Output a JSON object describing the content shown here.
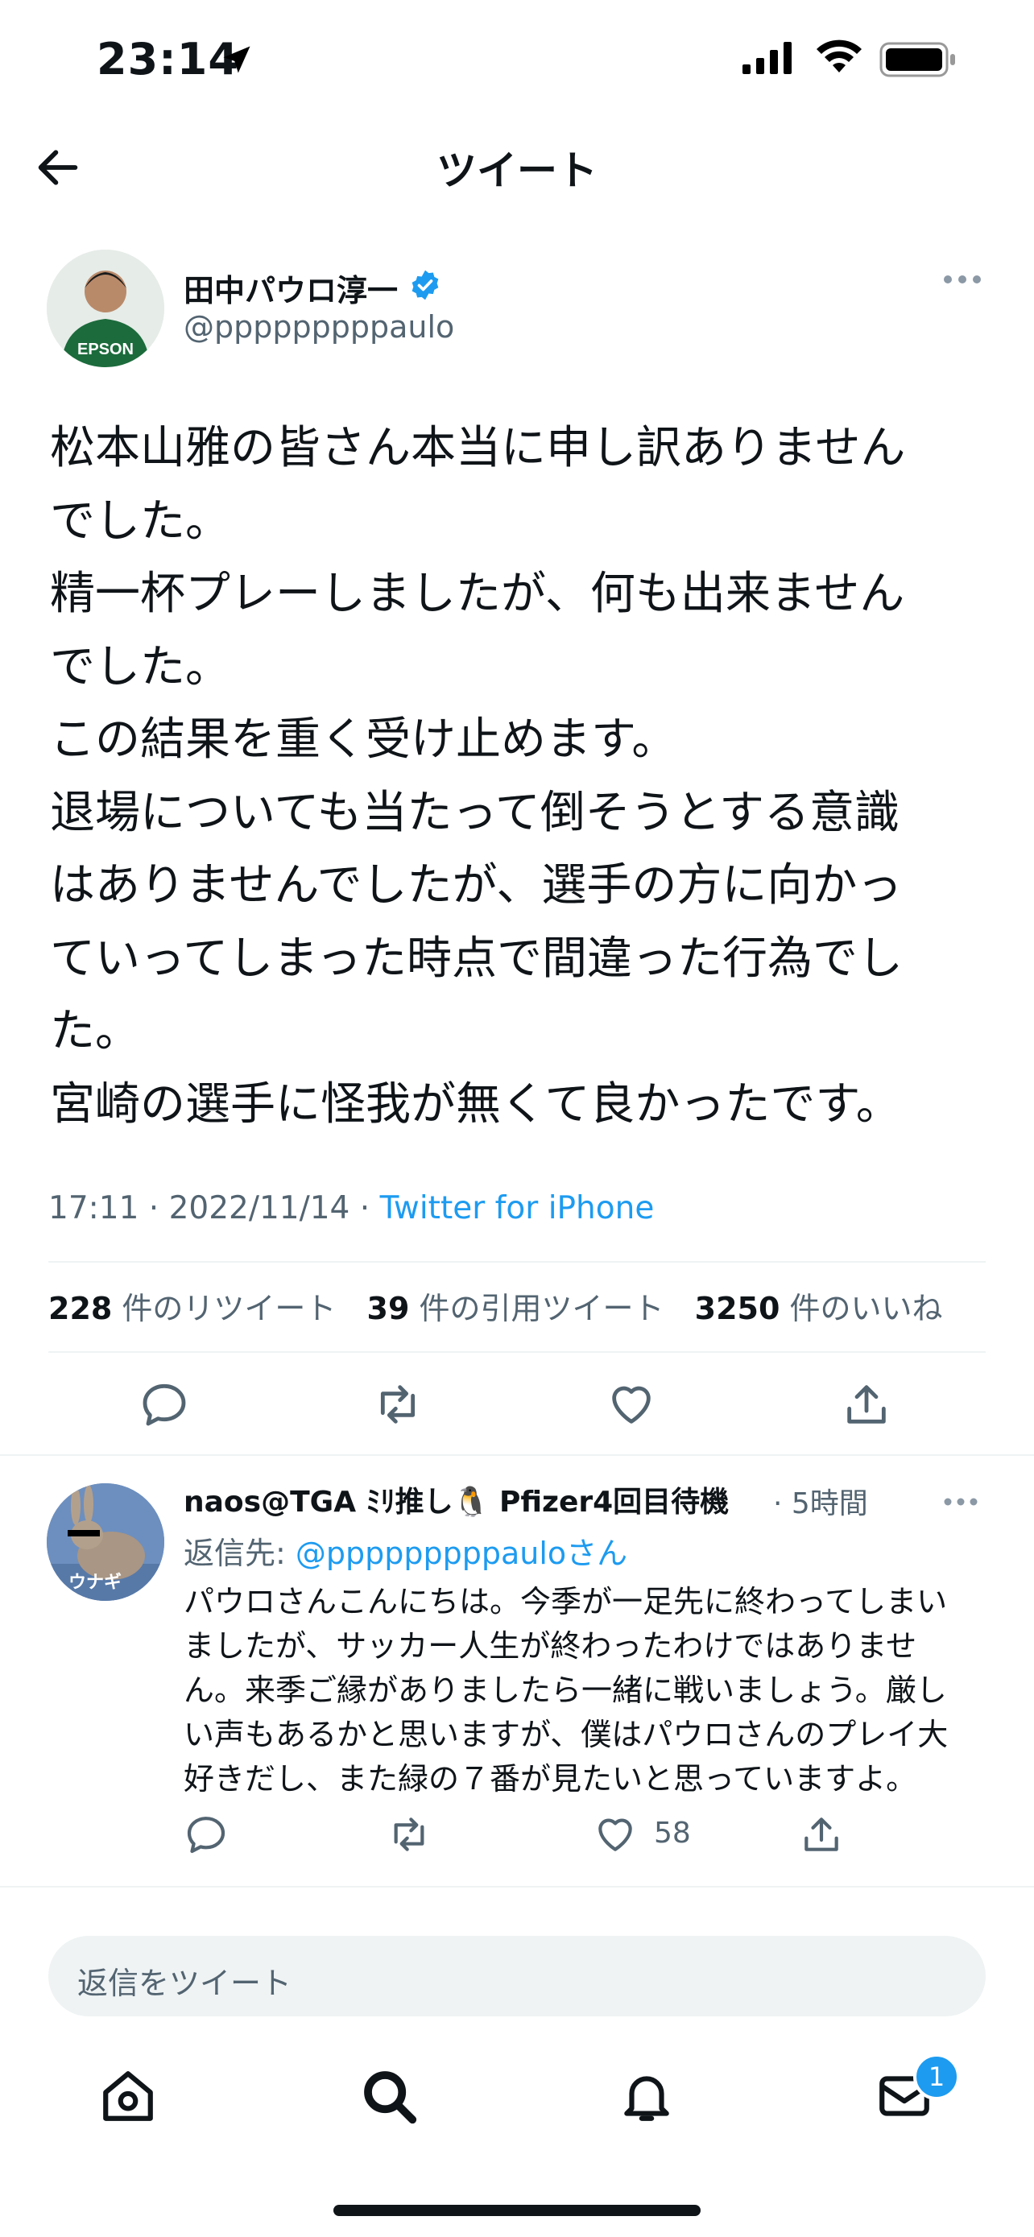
{
  "status_bar": {
    "time": "23:14"
  },
  "nav": {
    "title": "ツイート"
  },
  "tweet": {
    "author_name": "田中パウロ淳一",
    "author_handle": "@pppppppppaulo",
    "text": "松本山雅の皆さん本当に申し訳ありません\nでした。\n精一杯プレーしましたが、何も出来ません\nでした。\nこの結果を重く受け止めます。\n退場についても当たって倒そうとする意識\nはありませんでしたが、選手の方に向かっ\nていってしまった時点で間違った行為でし\nた。\n宮崎の選手に怪我が無くて良かったです。",
    "timestamp": "17:11 · 2022/11/14 · ",
    "source": "Twitter for iPhone",
    "retweets_count": "228",
    "retweets_label": "件のリツイート",
    "quotes_count": "39",
    "quotes_label": "件の引用ツイート",
    "likes_count": "3250",
    "likes_label": "件のいいね",
    "avatar_text": "EPSON"
  },
  "reply": {
    "author_name": "naos@TGA ﾐﾘ推し🐧 Pfizer4回目待機",
    "time": "· 5時間",
    "reply_to_prefix": "返信先: ",
    "reply_to_handle": "@pppppppppaulo",
    "reply_to_suffix": "さん",
    "text": "パウロさんこんにちは。今季が一足先に終わってしまい\nましたが、サッカー人生が終わったわけではありませ\nん。来季ご縁がありましたら一緒に戦いましょう。厳し\nい声もあるかと思いますが、僕はパウロさんのプレイ大\n好きだし、また緑の７番が見たいと思っていますよ。",
    "like_count": "58",
    "avatar_text": "ウナギ"
  },
  "composer": {
    "placeholder": "返信をツイート"
  },
  "tabbar": {
    "messages_badge": "1"
  },
  "colors": {
    "accent": "#1d9bf0",
    "muted": "#536471",
    "text": "#0f1419"
  }
}
